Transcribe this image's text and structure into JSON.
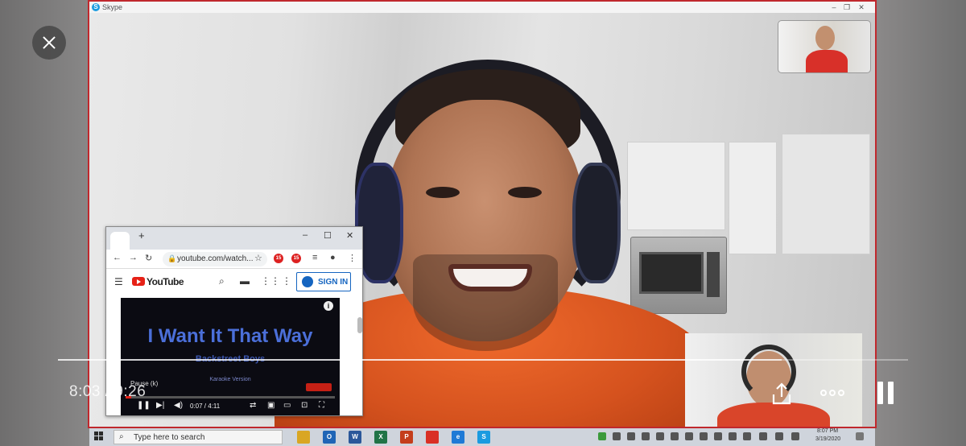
{
  "skype": {
    "title": "Skype",
    "logo_letter": "S",
    "controls": {
      "minimize": "–",
      "maximize": "❐",
      "close": "✕"
    }
  },
  "chrome": {
    "new_tab": "+",
    "controls": {
      "minimize": "–",
      "maximize": "☐",
      "close": "✕"
    },
    "url": "youtube.com/watch...",
    "extension_badges": [
      "15",
      "15"
    ],
    "youtube": {
      "logo_text": "YouTube",
      "signin_label": "SIGN IN",
      "info_glyph": "i",
      "video": {
        "title": "I Want It That Way",
        "artist": "Backstreet Boys",
        "subtitle": "Karaoke Version",
        "pause_label": "Pause (k)",
        "time": "0:07 / 4:11",
        "progress": 0.028
      }
    }
  },
  "taskbar": {
    "search_placeholder": "Type here to search",
    "apps": [
      {
        "name": "file-explorer",
        "label": "",
        "color": "#d9a623"
      },
      {
        "name": "outlook",
        "label": "O",
        "color": "#1f65b6"
      },
      {
        "name": "word",
        "label": "W",
        "color": "#2b579a"
      },
      {
        "name": "excel",
        "label": "X",
        "color": "#217346"
      },
      {
        "name": "powerpoint",
        "label": "P",
        "color": "#c43e1c"
      },
      {
        "name": "chrome",
        "label": "",
        "color": "#d93025"
      },
      {
        "name": "edge",
        "label": "e",
        "color": "#1e7ad6"
      },
      {
        "name": "skype",
        "label": "S",
        "color": "#1a9be0"
      }
    ],
    "clock_time": "8:07 PM",
    "clock_date": "3/19/2020"
  },
  "player": {
    "current_time": "8:03",
    "separator": " / ",
    "duration": "9:26",
    "progress": 0.851
  }
}
